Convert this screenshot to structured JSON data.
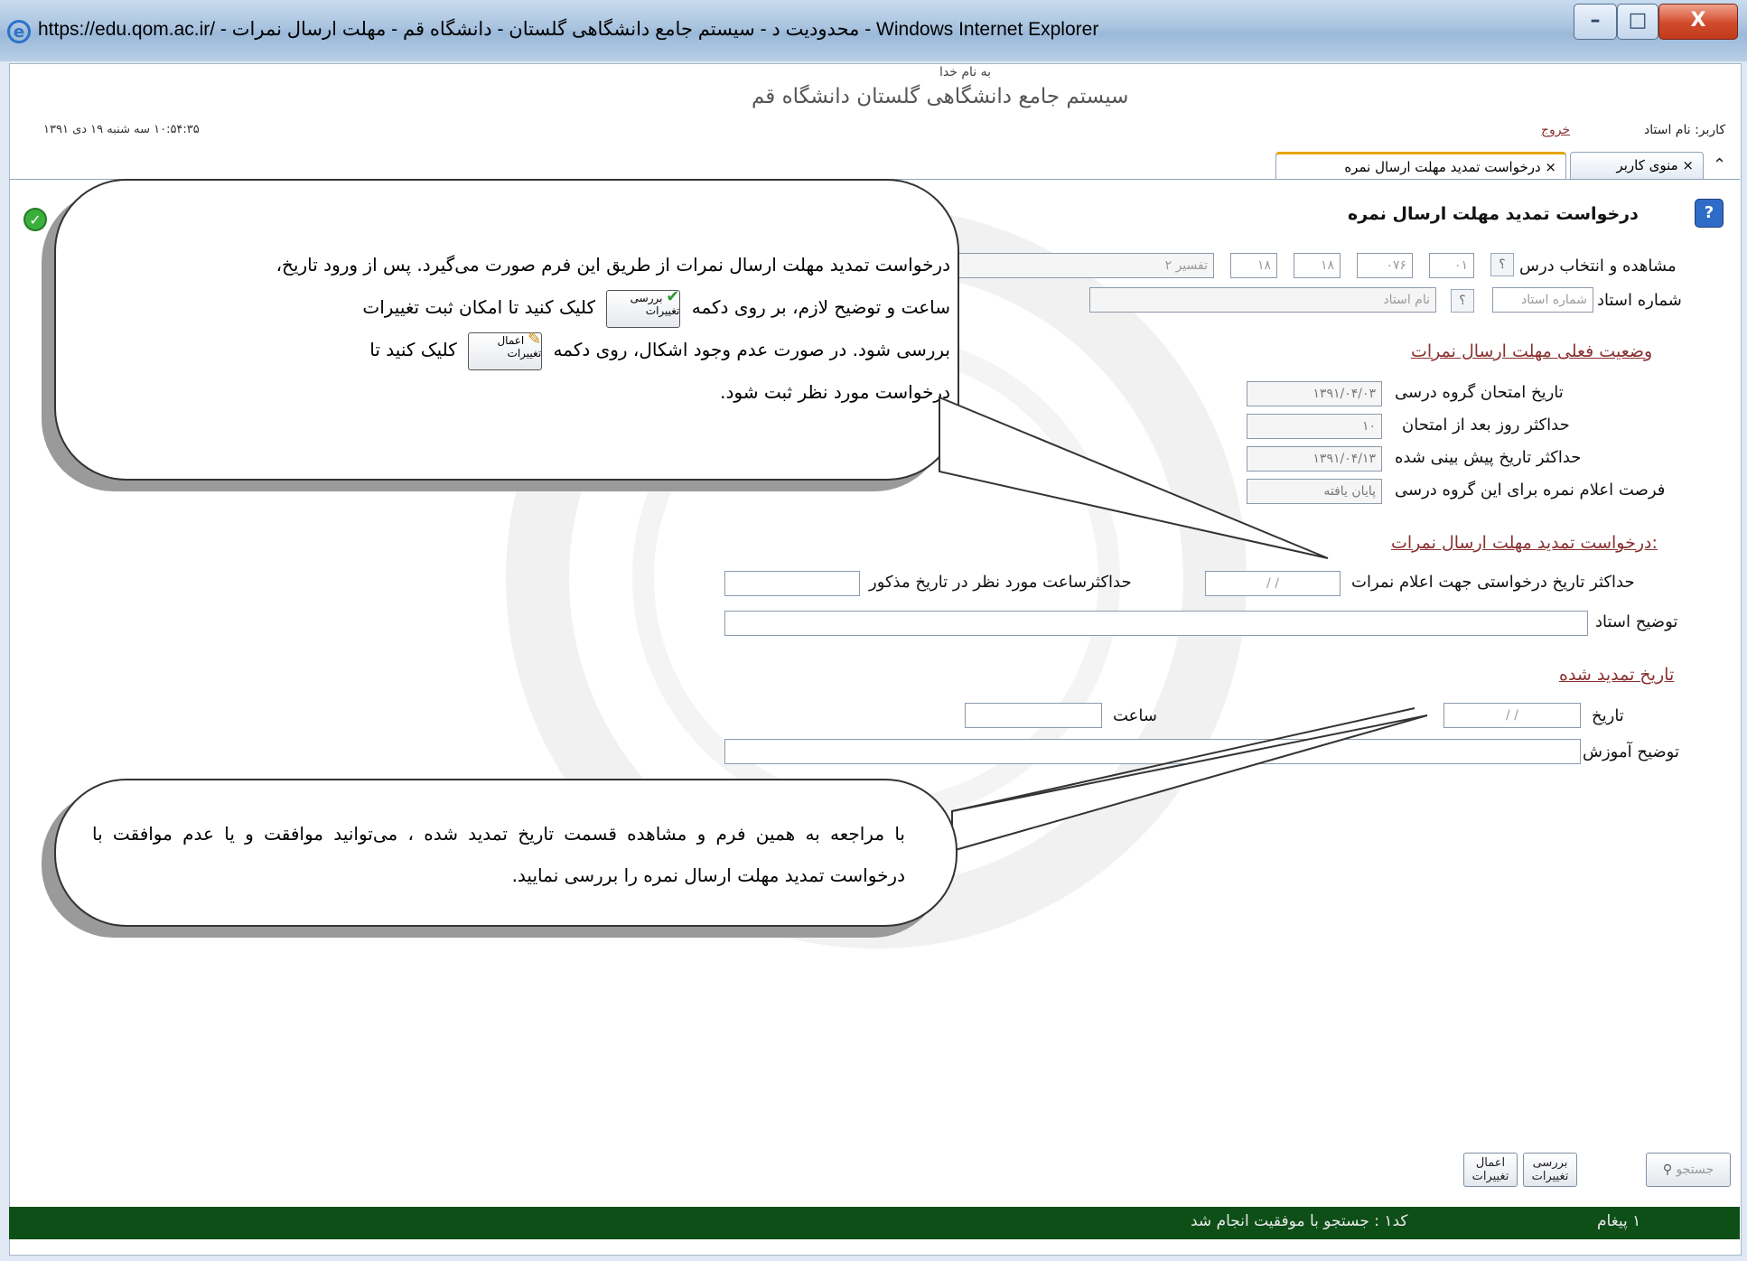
{
  "window": {
    "title": "https://edu.qom.ac.ir/ - محدودیت د - سیستم جامع دانشگاهی گلستان - دانشگاه قم - مهلت ارسال نمرات - Windows Internet Explorer",
    "minimize": "–",
    "maximize": "□",
    "close": "X"
  },
  "header": {
    "bismillah": "به نام خدا",
    "system_name": "سیستم جامع دانشگاهی گلستان   دانشگاه قم",
    "datetime": "۱۰:۵۴:۳۵ سه شنبه ۱۹ دی ۱۳۹۱",
    "user_label": "کاربر: نام استاد",
    "logout": "خروج"
  },
  "tabs": [
    {
      "label": "× منوی کاربر"
    },
    {
      "label": "× درخواست تمدید مهلت ارسال نمره"
    }
  ],
  "form": {
    "title": "درخواست تمدید مهلت ارسال نمره",
    "course_label": "مشاهده و انتخاب درس",
    "course_values": [
      "۰۱",
      "۰۷۶",
      "۱۸",
      "۱۸",
      "تفسیر ۲"
    ],
    "teacher_label": "شماره استاد",
    "teacher_number_placeholder": "شماره استاد",
    "teacher_name_placeholder": "نام استاد",
    "current_status_title": "وضعیت فعلی مهلت ارسال نمرات",
    "exam_date_label": "تاریخ امتحان گروه درسی",
    "exam_date_value": "۱۳۹۱/۰۴/۰۳",
    "max_days_label": "حداکثر روز بعد از امتحان",
    "max_days_value": "۱۰",
    "max_predicted_label": "حداکثر تاریخ پیش بینی شده",
    "max_predicted_value": "۱۳۹۱/۰۴/۱۳",
    "opportunity_label": "فرصت اعلام نمره برای این گروه درسی",
    "opportunity_value": "پایان یافته",
    "request_title": ":درخواست تمدید مهلت ارسال نمرات",
    "requested_date_label": "حداکثر تاریخ درخواستی جهت اعلام نمرات",
    "requested_date_value": "/     /",
    "max_hour_label": "حداکثرساعت مورد نظر در تاریخ مذکور",
    "teacher_note_label": "توضیح استاد",
    "extended_title": "تاریخ تمدید شده",
    "date_label": "تاریخ",
    "date_value": "/     /",
    "hour_label": "ساعت",
    "education_note_label": "توضیح آموزش"
  },
  "callouts": {
    "first": "درخواست تمدید مهلت ارسال نمرات از طریق این فرم صورت می‌گیرد. پس از ورود تاریخ، ساعت و توضیح لازم، بر روی دکمه [بررسی تغییرات] کلیک کنید تا امکان ثبت تغییرات بررسی شود. در صورت عدم وجود اشکال، روی دکمه [اعمال تغییرات] کلیک کنید تا درخواست مورد نظر ثبت شود.",
    "first_lines": [
      "درخواست تمدید مهلت ارسال نمرات از طریق این فرم صورت می‌گیرد. پس از ورود تاریخ،",
      "ساعت و توضیح لازم، بر روی دکمه",
      "کلیک کنید تا امکان ثبت تغییرات",
      "بررسی شود. در صورت عدم وجود اشکال، روی دکمه",
      "کلیک کنید تا",
      "درخواست مورد نظر ثبت شود."
    ],
    "second": "با مراجعه به همین فرم و مشاهده قسمت تاریخ تمدید شده ، می‌توانید موافقت و یا عدم موافقت با درخواست تمدید مهلت ارسال نمره را بررسی نمایید."
  },
  "toolbar": {
    "search": "جستجو",
    "review_line1": "بررسی",
    "review_line2": "تغییرات",
    "apply_line1": "اعمال",
    "apply_line2": "تغییرات"
  },
  "status": {
    "messages": "۱ پیغام",
    "text": "کد۱ : جستجو با موفقیت انجام شد"
  }
}
